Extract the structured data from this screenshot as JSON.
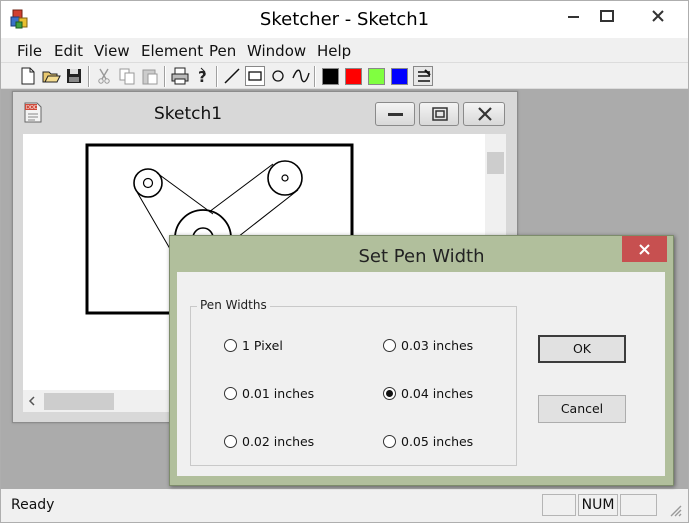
{
  "window": {
    "title": "Sketcher - Sketch1"
  },
  "menu": [
    "File",
    "Edit",
    "View",
    "Element",
    "Pen",
    "Window",
    "Help"
  ],
  "toolbar": {
    "icons": [
      "new-file-icon",
      "open-folder-icon",
      "save-icon",
      "cut-icon",
      "copy-icon",
      "paste-icon",
      "print-icon",
      "help-icon",
      "line-tool-icon",
      "rectangle-tool-icon",
      "circle-tool-icon",
      "curve-tool-icon",
      "color-black",
      "color-red",
      "color-green",
      "color-blue",
      "pen-width-icon"
    ],
    "colors": {
      "black": "#000000",
      "red": "#ff0000",
      "green": "#80ff40",
      "blue": "#0000ff"
    }
  },
  "child": {
    "title": "Sketch1"
  },
  "dialog": {
    "title": "Set Pen Width",
    "group_label": "Pen Widths",
    "options": [
      {
        "label": "1 Pixel",
        "selected": false
      },
      {
        "label": "0.01 inches",
        "selected": false
      },
      {
        "label": "0.02 inches",
        "selected": false
      },
      {
        "label": "0.03 inches",
        "selected": false
      },
      {
        "label": "0.04 inches",
        "selected": true
      },
      {
        "label": "0.05 inches",
        "selected": false
      }
    ],
    "ok_label": "OK",
    "cancel_label": "Cancel"
  },
  "status": {
    "text": "Ready",
    "num": "NUM"
  }
}
